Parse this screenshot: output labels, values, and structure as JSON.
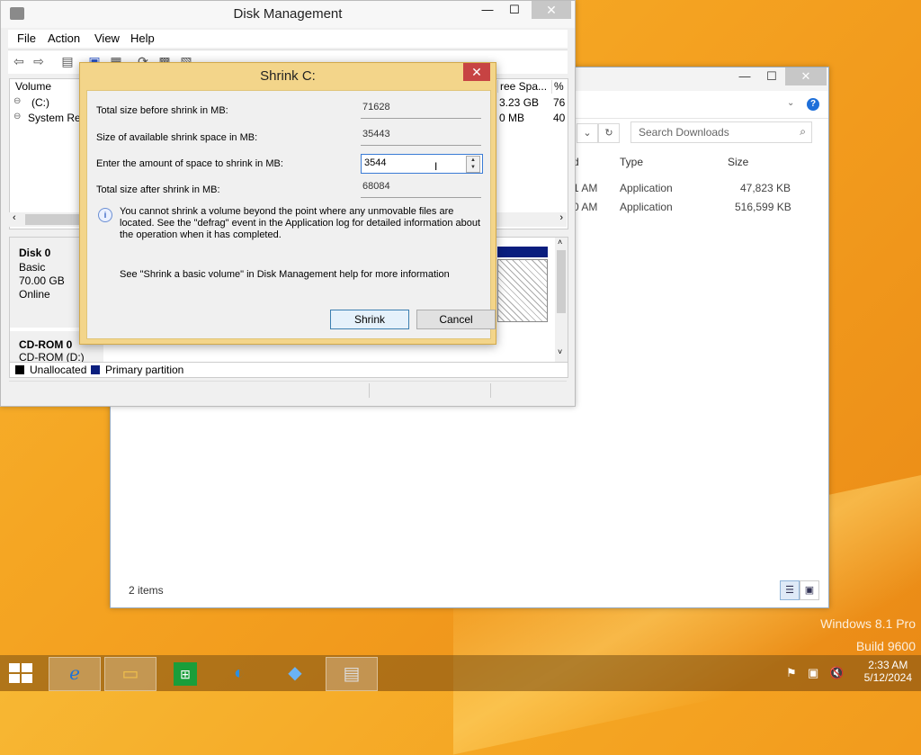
{
  "desktop": {
    "watermark_line1": "Windows 8.1 Pro",
    "watermark_line2": "Build 9600"
  },
  "explorer": {
    "search_placeholder": "Search Downloads",
    "columns": {
      "type": "Type",
      "size": "Size"
    },
    "rows": [
      {
        "time": "1 AM",
        "type": "Application",
        "size": "47,823 KB"
      },
      {
        "time": "0 AM",
        "type": "Application",
        "size": "516,599 KB"
      }
    ],
    "status": "2 items",
    "partial_col": "d"
  },
  "disk_mgmt": {
    "title": "Disk Management",
    "menu": [
      "File",
      "Action",
      "View",
      "Help"
    ],
    "columns": {
      "volume": "Volume",
      "free_space": "ree Spa...",
      "pct_free": "% F"
    },
    "volumes": [
      {
        "name": "(C:)",
        "free": "3.23 GB",
        "pct": "76"
      },
      {
        "name": "System Res",
        "free": "0 MB",
        "pct": "40"
      }
    ],
    "disk0": {
      "name": "Disk 0",
      "type": "Basic",
      "size": "70.00 GB",
      "status": "Online"
    },
    "cdrom": {
      "name": "CD-ROM 0",
      "label": "CD-ROM (D:)"
    },
    "legend": {
      "unallocated": "Unallocated",
      "primary": "Primary partition"
    },
    "colors": {
      "unallocated": "#000000",
      "primary": "#0a1e7e"
    }
  },
  "shrink_dialog": {
    "title": "Shrink C:",
    "total_before_label": "Total size before shrink in MB:",
    "total_before_value": "71628",
    "available_label": "Size of available shrink space in MB:",
    "available_value": "35443",
    "amount_label": "Enter the amount of space to shrink in MB:",
    "amount_value": "3544",
    "total_after_label": "Total size after shrink in MB:",
    "total_after_value": "68084",
    "info_text": "You cannot shrink a volume beyond the point where any unmovable files are located. See the \"defrag\" event in the Application log for detailed information about the operation when it has completed.",
    "help_text": "See \"Shrink a basic volume\" in Disk Management help for more information",
    "shrink_button": "Shrink",
    "cancel_button": "Cancel"
  },
  "taskbar": {
    "time": "2:33 AM",
    "date": "5/12/2024"
  }
}
